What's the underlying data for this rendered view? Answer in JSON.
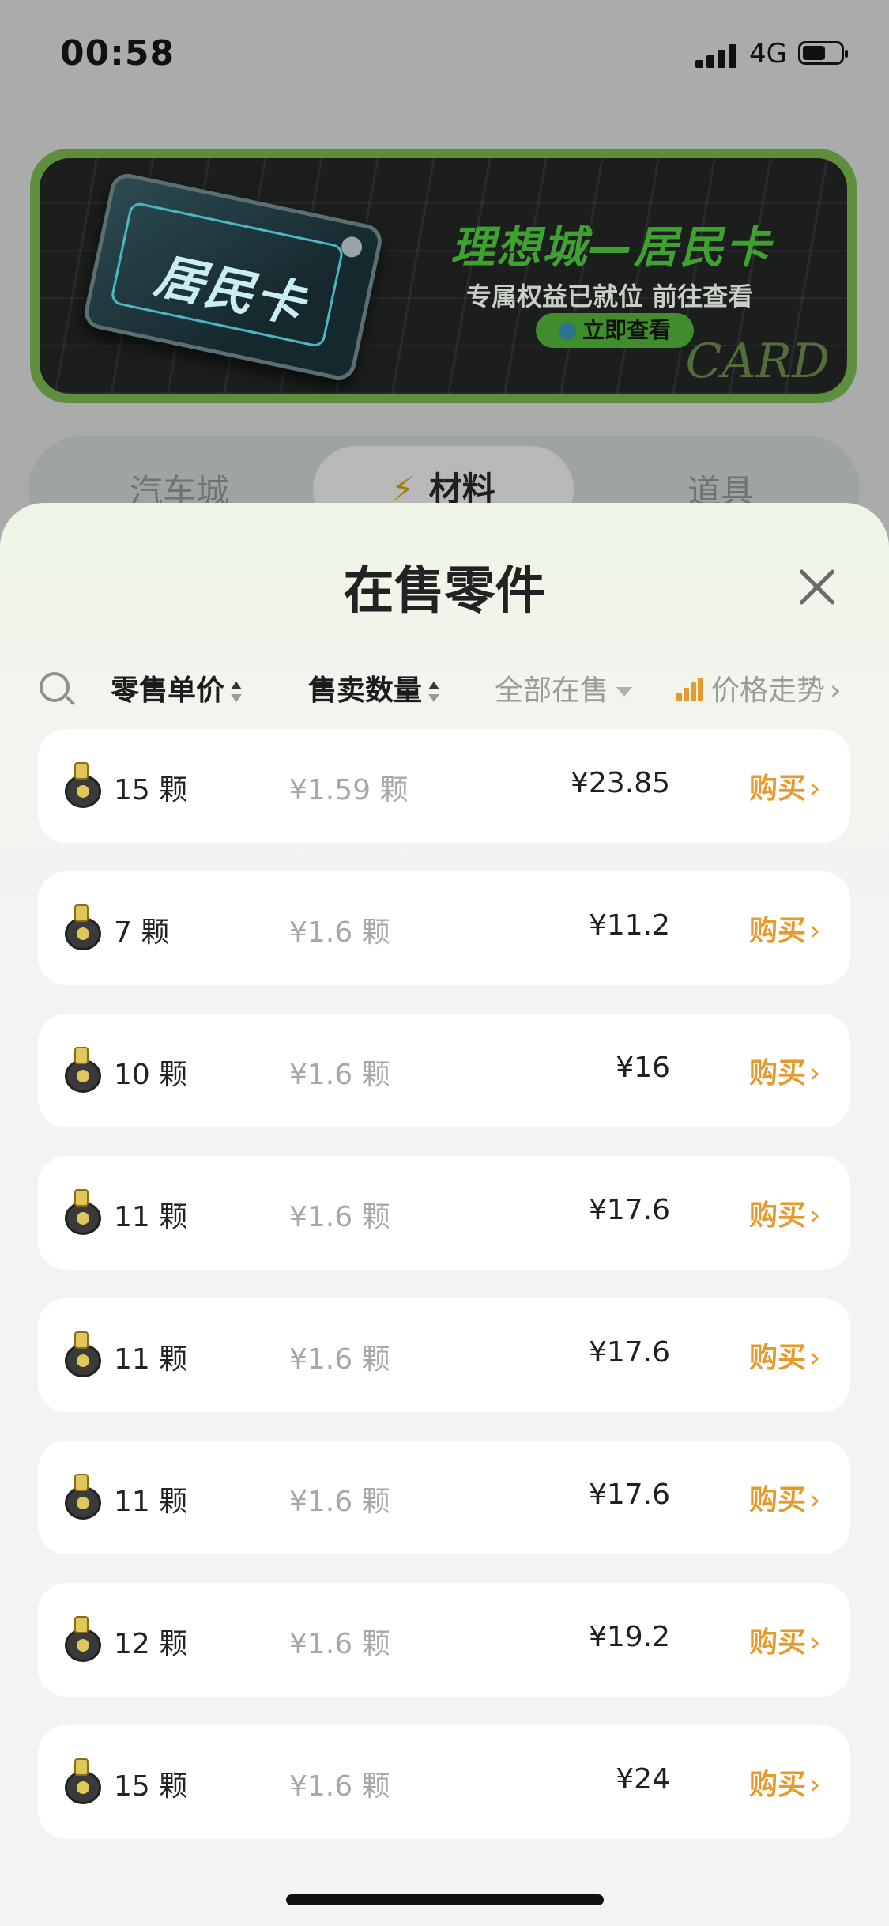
{
  "status_bar": {
    "time": "00:58",
    "network": "4G"
  },
  "banner": {
    "card_text": "居民卡",
    "title": "理想城—居民卡",
    "subtitle": "专属权益已就位 前往查看",
    "button": "立即查看",
    "deco": "CARD"
  },
  "tabs": [
    {
      "label": "汽车城"
    },
    {
      "label": "材料"
    },
    {
      "label": "道具"
    }
  ],
  "sheet": {
    "title": "在售零件",
    "filters": {
      "unit_price": "零售单价",
      "quantity": "售卖数量",
      "status": "全部在售",
      "trend": "价格走势"
    },
    "buy_label": "购买",
    "listings": [
      {
        "qty": "15 颗",
        "unit": "¥1.59 颗",
        "total": "¥23.85"
      },
      {
        "qty": "7 颗",
        "unit": "¥1.6 颗",
        "total": "¥11.2"
      },
      {
        "qty": "10 颗",
        "unit": "¥1.6 颗",
        "total": "¥16"
      },
      {
        "qty": "11 颗",
        "unit": "¥1.6 颗",
        "total": "¥17.6"
      },
      {
        "qty": "11 颗",
        "unit": "¥1.6 颗",
        "total": "¥17.6"
      },
      {
        "qty": "11 颗",
        "unit": "¥1.6 颗",
        "total": "¥17.6"
      },
      {
        "qty": "12 颗",
        "unit": "¥1.6 颗",
        "total": "¥19.2"
      },
      {
        "qty": "15 颗",
        "unit": "¥1.6 颗",
        "total": "¥24"
      }
    ]
  },
  "colors": {
    "accent": "#e69a2b",
    "banner_green": "#3fa130"
  },
  "icons": [
    "signal-icon",
    "battery-icon",
    "bolt-icon",
    "close-icon",
    "search-icon",
    "trend-chart-icon",
    "part-icon",
    "chevron-right-icon"
  ]
}
